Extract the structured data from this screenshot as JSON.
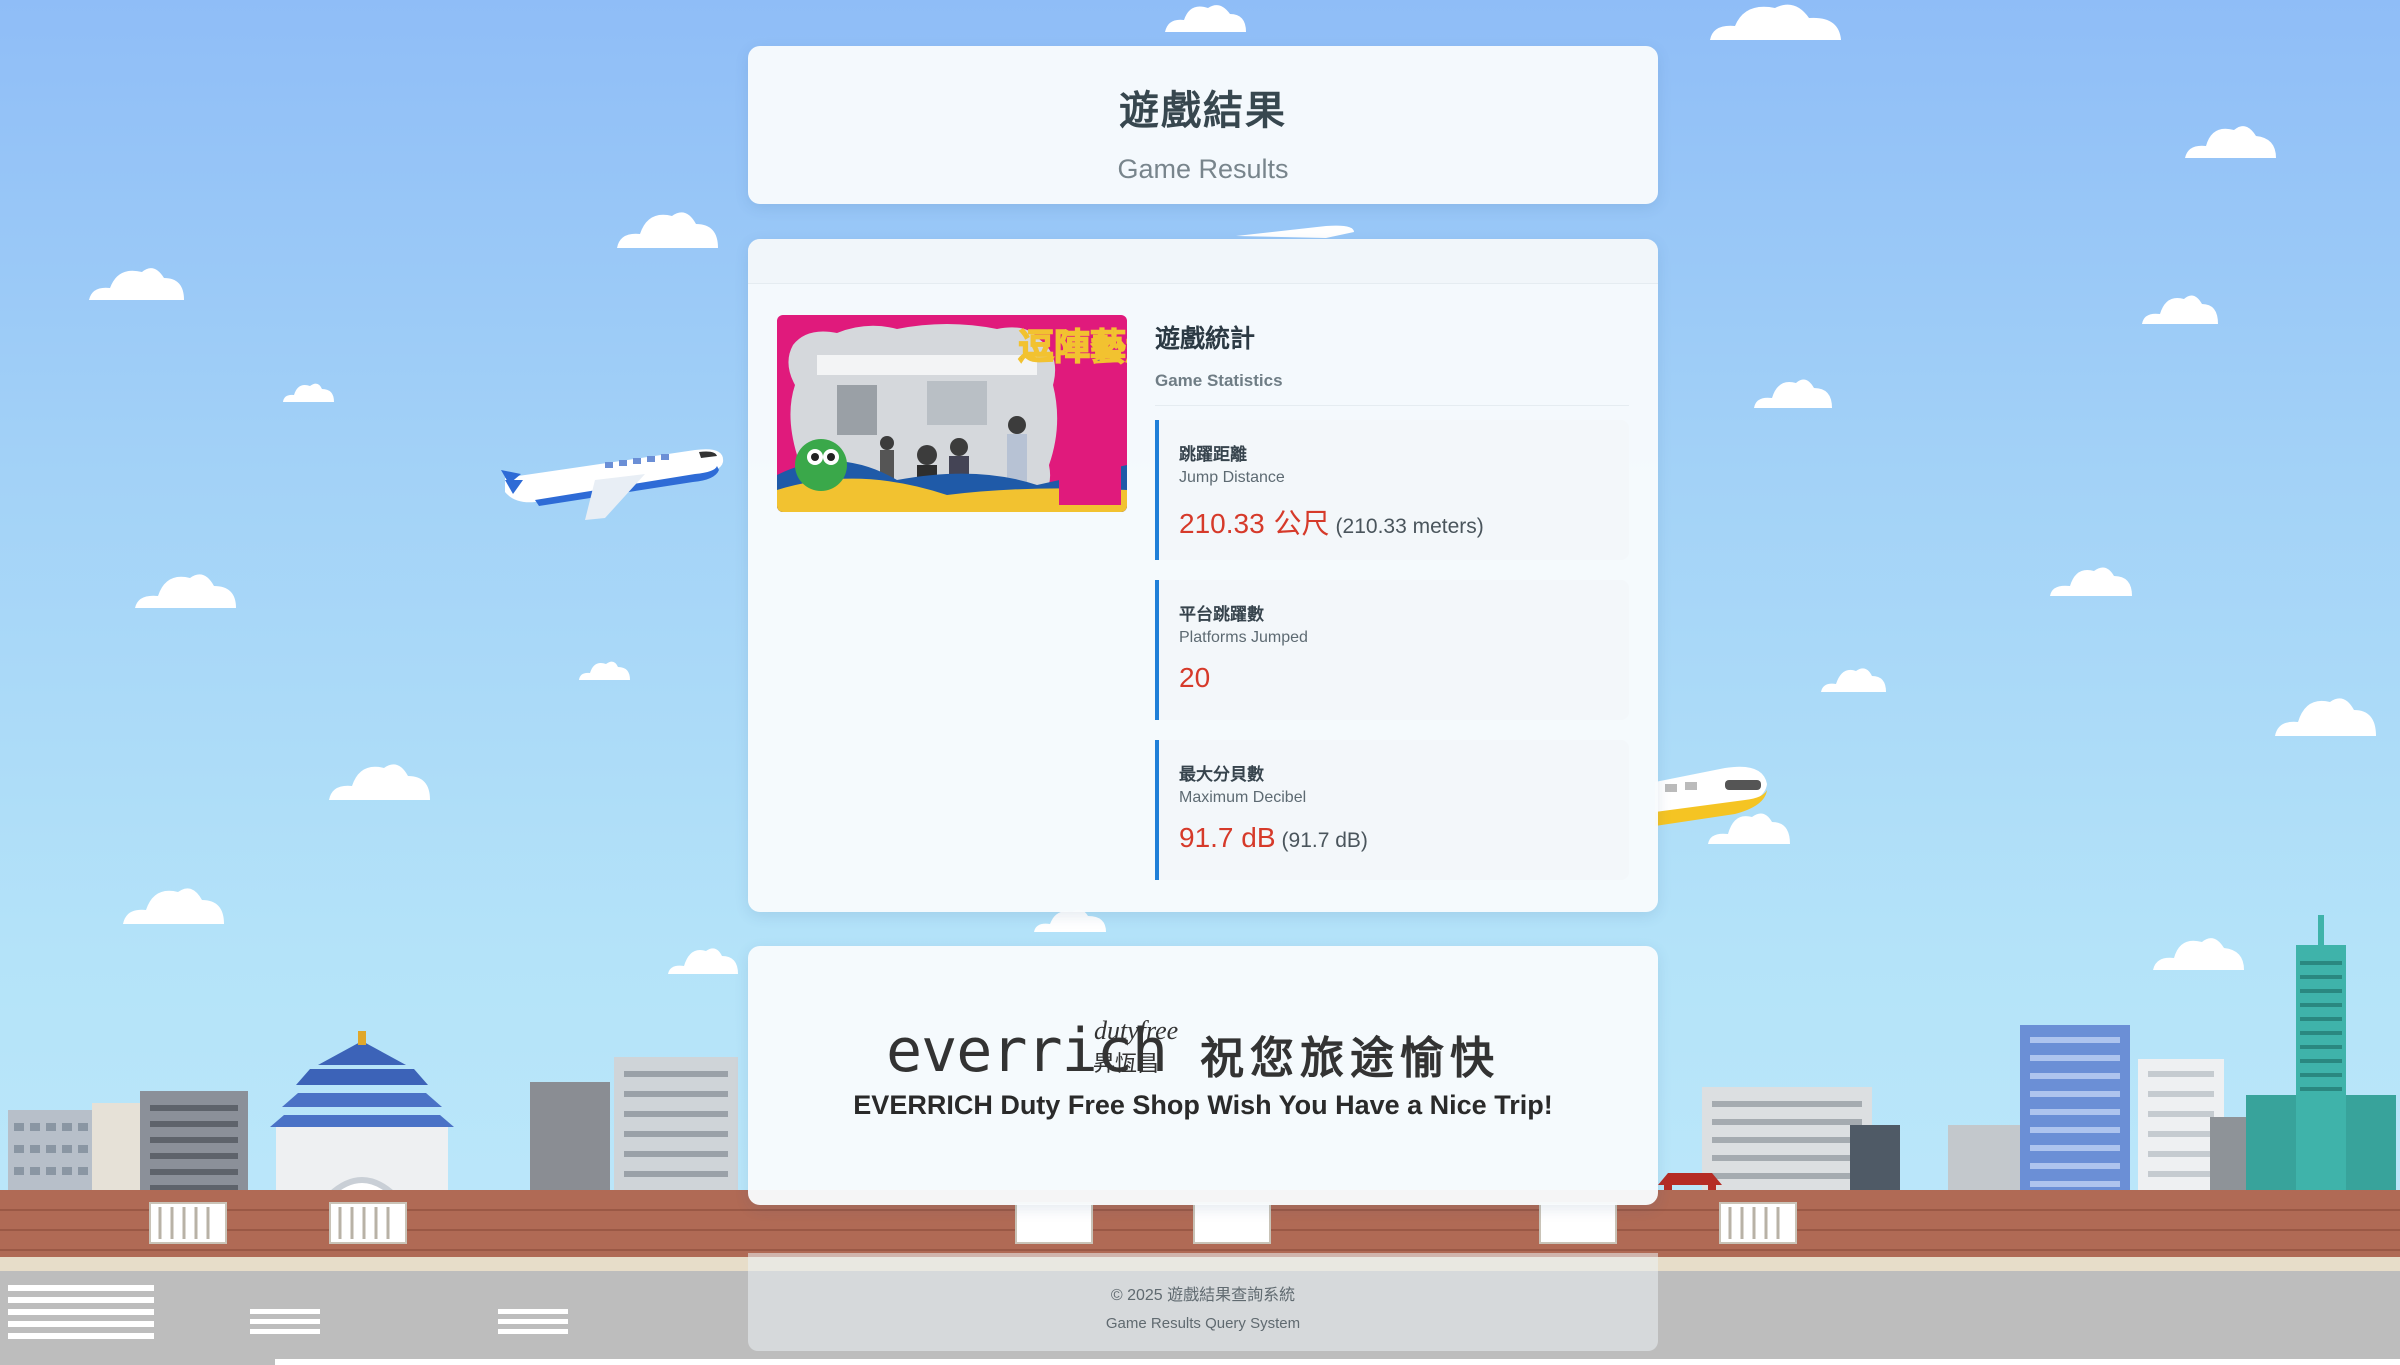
{
  "header": {
    "title_zh": "遊戲結果",
    "title_en": "Game Results"
  },
  "stats": {
    "title_zh": "遊戲統計",
    "title_en": "Game Statistics",
    "photo_alt": "逗陣藝起",
    "items": [
      {
        "label_zh": "跳躍距離",
        "label_en": "Jump Distance",
        "value": "210.33",
        "unit": " 公尺",
        "note": "(210.33 meters)"
      },
      {
        "label_zh": "平台跳躍數",
        "label_en": "Platforms Jumped",
        "value": "20",
        "unit": "",
        "note": ""
      },
      {
        "label_zh": "最大分貝數",
        "label_en": "Maximum Decibel",
        "value": "91.7 dB",
        "unit": "",
        "note": "(91.7 dB)"
      }
    ]
  },
  "promo": {
    "logo_word": "everrich",
    "logo_duty": "dutyfree",
    "logo_zh": "昇恆昌",
    "slogan_zh": "祝您旅途愉快",
    "slogan_en": "EVERRICH Duty Free Shop Wish You Have a Nice Trip!"
  },
  "footer": {
    "copyright": "© 2025 遊戲結果查詢系統",
    "system": "Game Results Query System"
  },
  "colors": {
    "accent": "#1f7fd8",
    "value": "#d63a2a"
  }
}
